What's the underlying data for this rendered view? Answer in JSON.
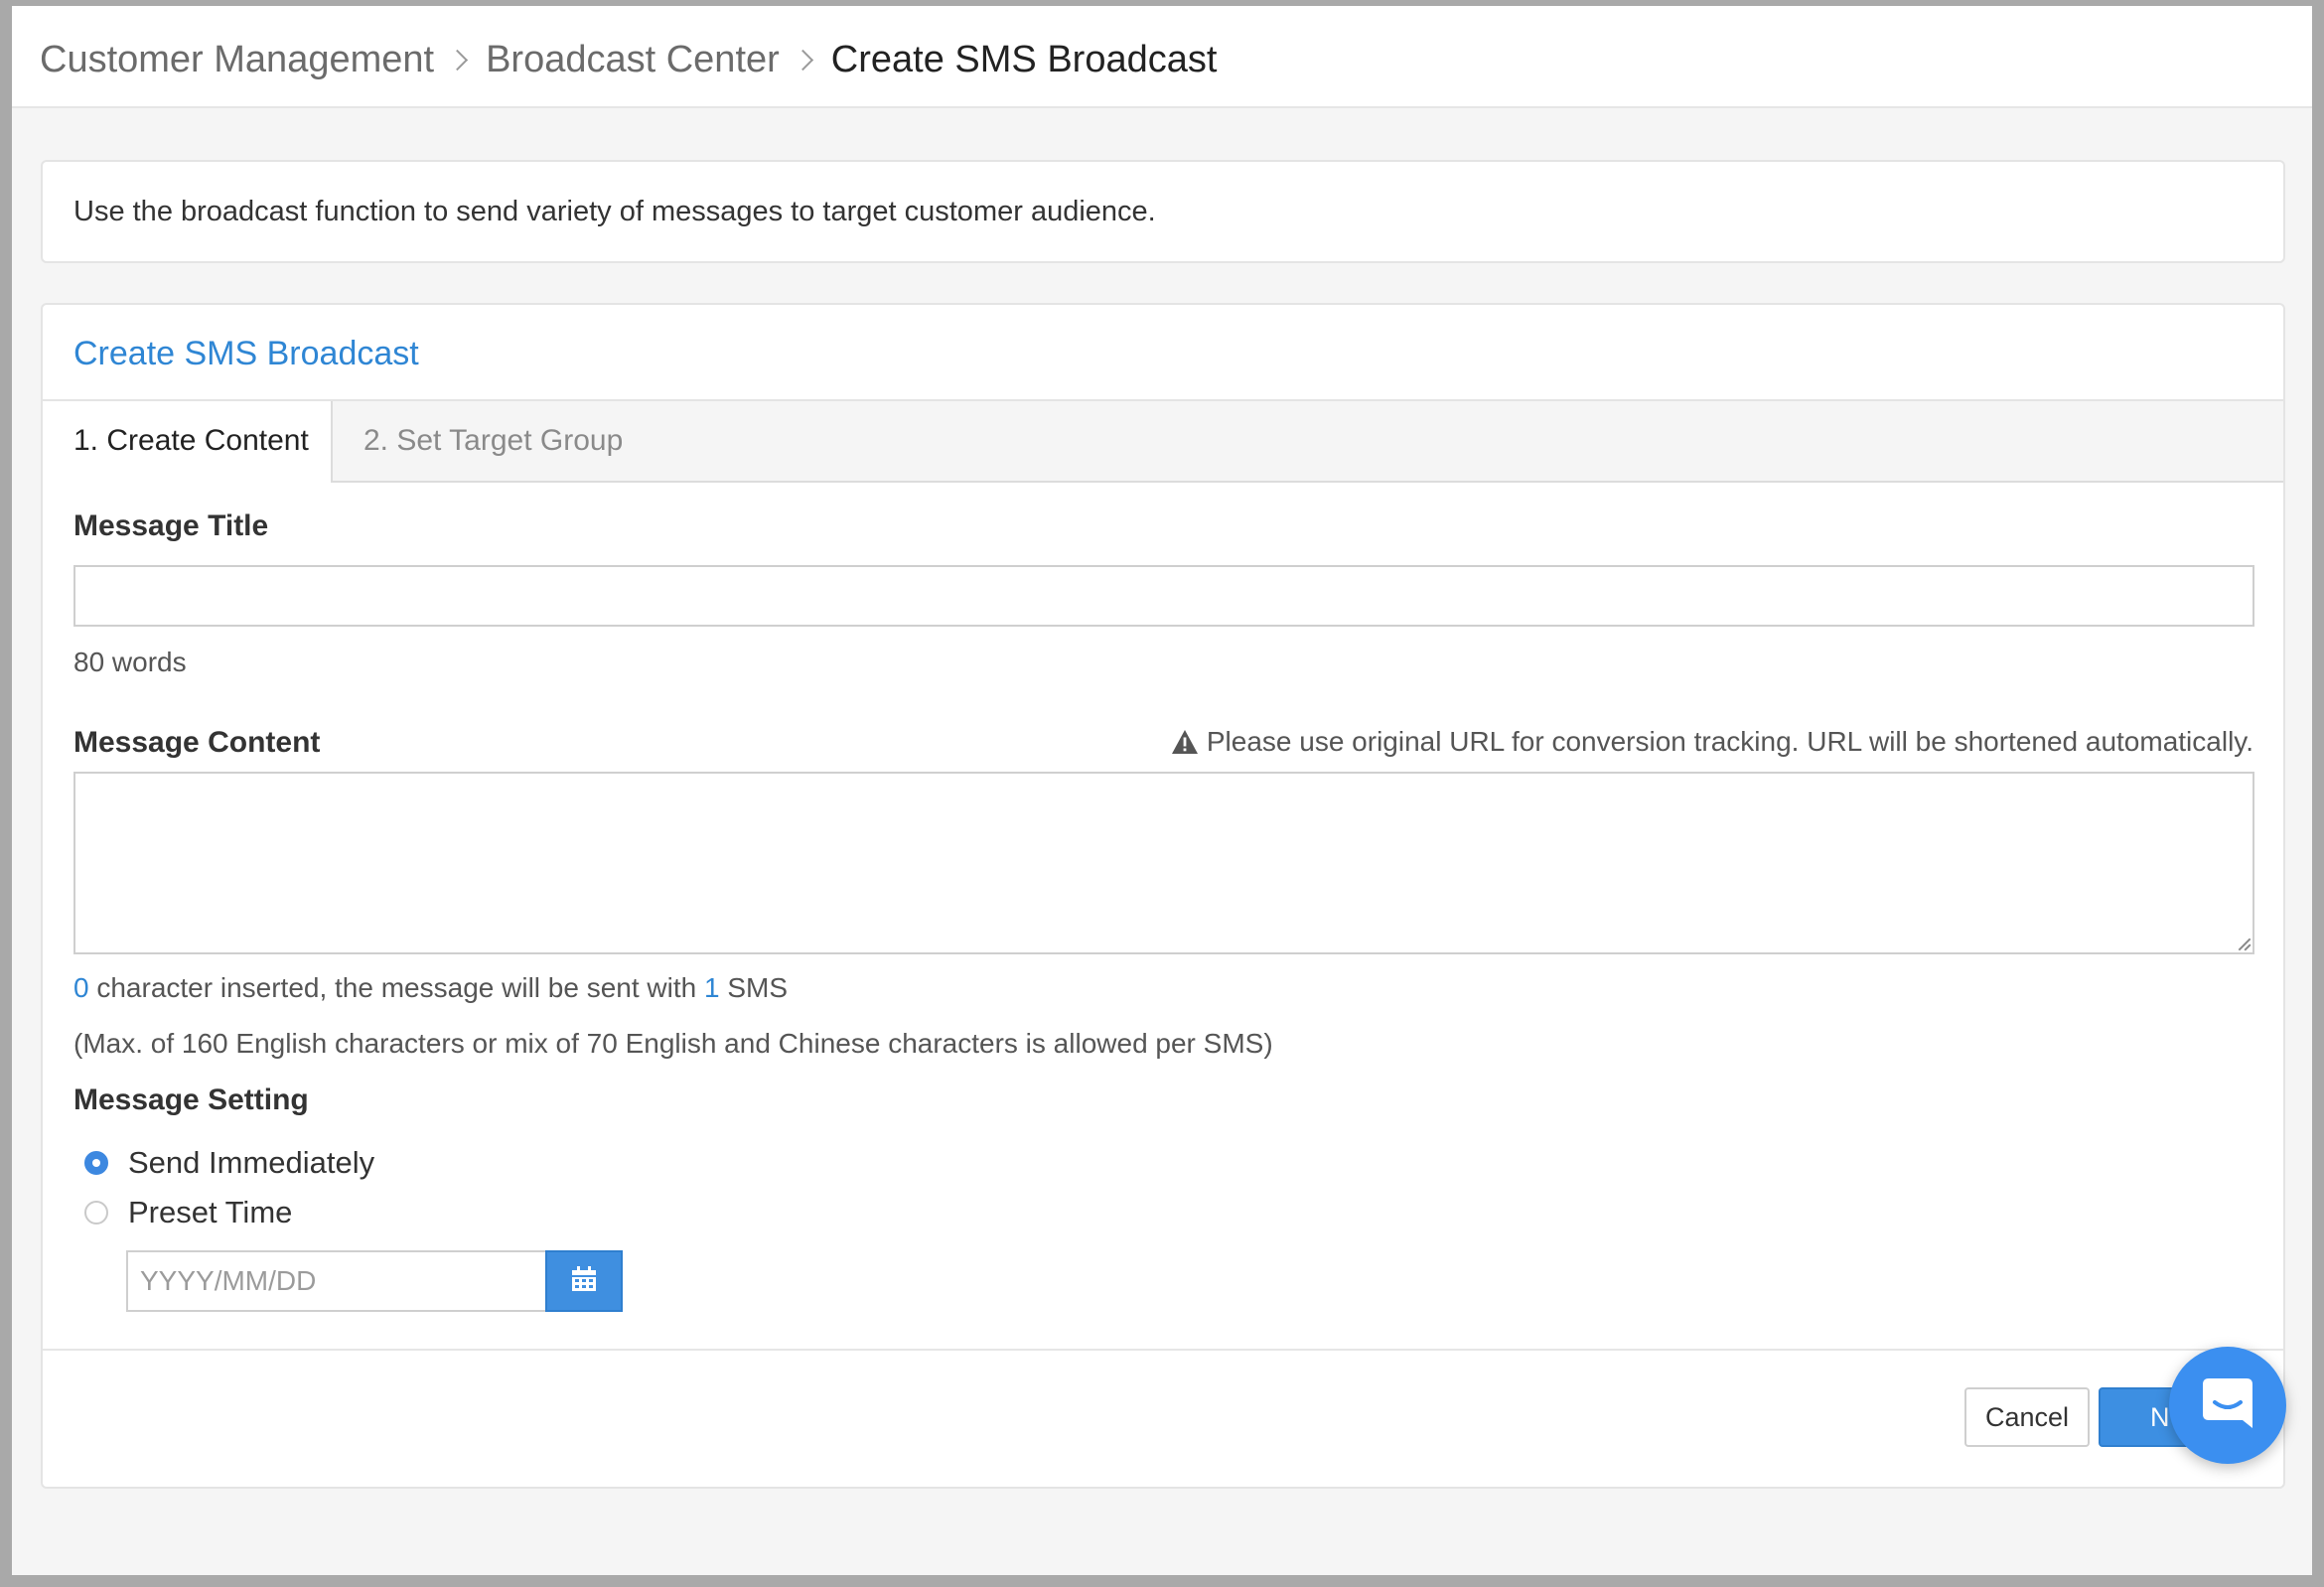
{
  "breadcrumb": {
    "items": [
      "Customer Management",
      "Broadcast Center"
    ],
    "current": "Create SMS Broadcast"
  },
  "info": {
    "text": "Use the broadcast function to send variety of messages to target customer audience."
  },
  "panel": {
    "title": "Create SMS Broadcast",
    "tabs": [
      {
        "label": "1. Create Content",
        "active": true
      },
      {
        "label": "2. Set Target Group",
        "active": false
      }
    ]
  },
  "form": {
    "message_title": {
      "label": "Message Title",
      "value": "",
      "helper": "80 words"
    },
    "message_content": {
      "label": "Message Content",
      "warning": "Please use original URL for conversion tracking. URL will be shortened automatically.",
      "value": "",
      "char_count": "0",
      "count_text_a": "character inserted, the message will be sent with",
      "sms_count": "1",
      "count_text_b": "SMS",
      "limit_note": "(Max. of 160 English characters or mix of 70 English and Chinese characters is allowed per SMS)"
    },
    "message_setting": {
      "label": "Message Setting",
      "options": [
        {
          "label": "Send Immediately",
          "selected": true
        },
        {
          "label": "Preset Time",
          "selected": false
        }
      ],
      "date_placeholder": "YYYY/MM/DD"
    }
  },
  "actions": {
    "cancel_label": "Cancel",
    "next_label_visible": "N"
  },
  "colors": {
    "accent": "#2f86d4",
    "primary_button": "#3d8fe2",
    "chat_fab": "#3b8ff0"
  },
  "icons": {
    "breadcrumb_separator": "chevron-right-icon",
    "warning": "warning-triangle-icon",
    "calendar": "calendar-icon",
    "chat": "chat-bubble-icon"
  }
}
